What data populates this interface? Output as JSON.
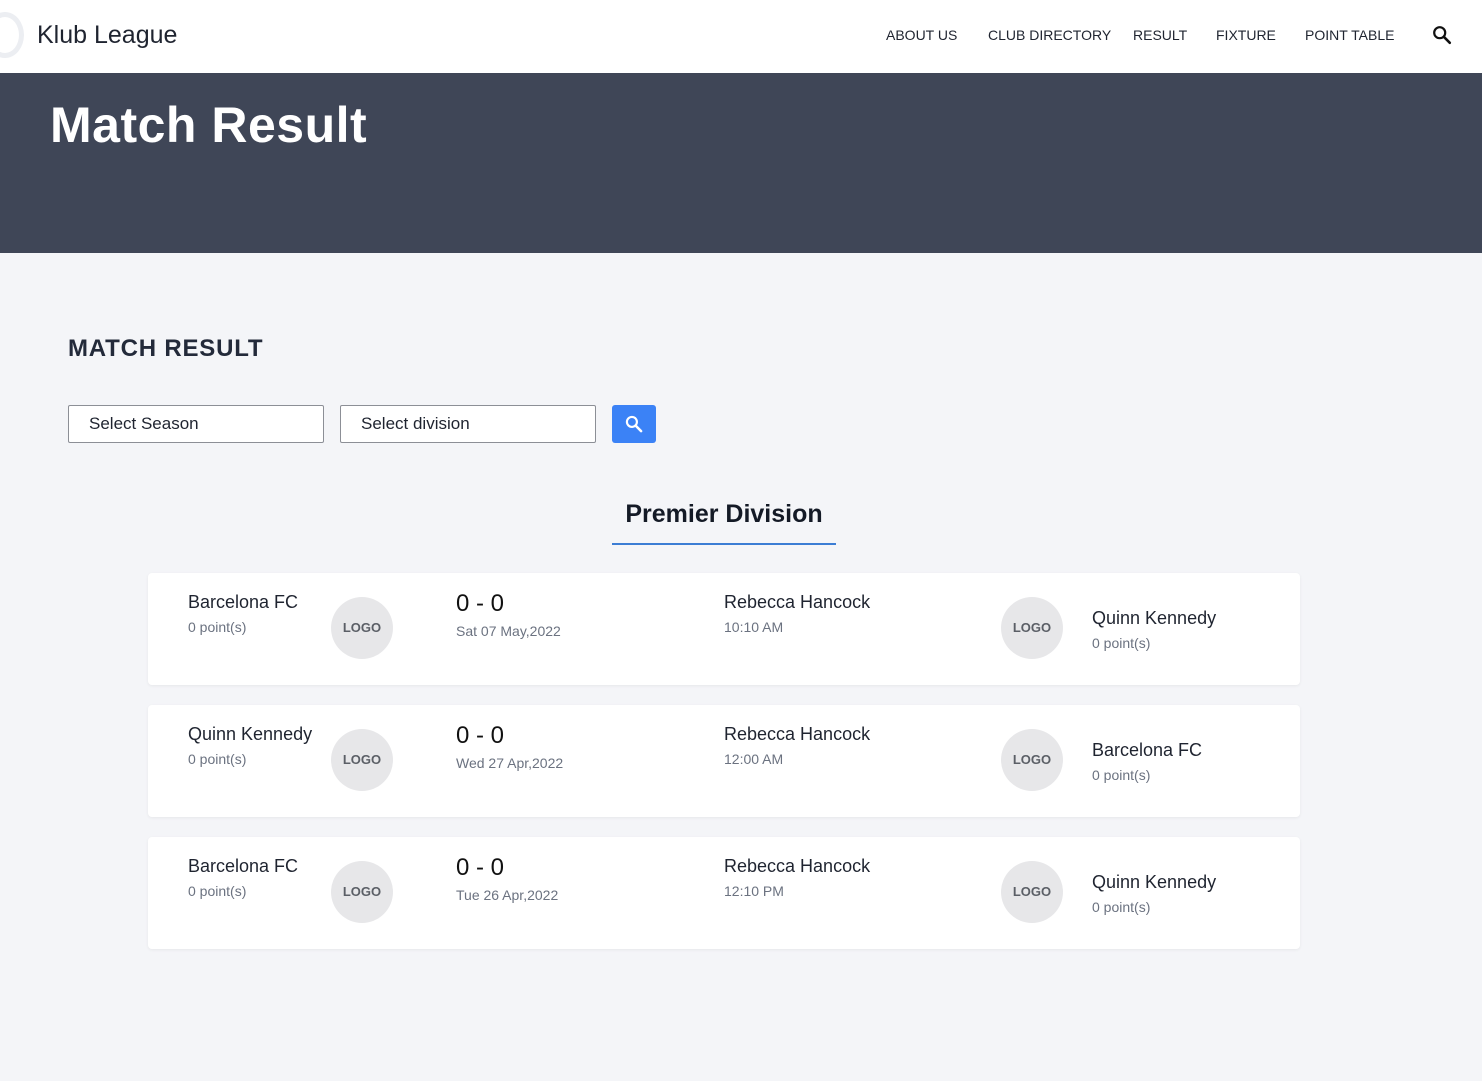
{
  "header": {
    "brand": "Klub League",
    "nav": [
      {
        "label": "ABOUT US"
      },
      {
        "label": "CLUB DIRECTORY"
      },
      {
        "label": "RESULT"
      },
      {
        "label": "FIXTURE"
      },
      {
        "label": "POINT TABLE"
      }
    ],
    "search_icon": "search-icon"
  },
  "hero": {
    "title": "Match Result"
  },
  "main": {
    "heading": "MATCH RESULT",
    "filters": {
      "season_placeholder": "Select Season",
      "division_placeholder": "Select division",
      "search_button_icon": "search-icon",
      "accent_color": "#3b82f6"
    },
    "division_tab": "Premier Division",
    "matches": [
      {
        "home": {
          "name": "Barcelona FC",
          "points": "0 point(s)",
          "logo": "LOGO"
        },
        "score": "0 - 0",
        "date": "Sat 07 May,2022",
        "venue": "Rebecca Hancock",
        "time": "10:10 AM",
        "away": {
          "name": "Quinn Kennedy",
          "points": "0 point(s)",
          "logo": "LOGO"
        }
      },
      {
        "home": {
          "name": "Quinn Kennedy",
          "points": "0 point(s)",
          "logo": "LOGO"
        },
        "score": "0 - 0",
        "date": "Wed 27 Apr,2022",
        "venue": "Rebecca Hancock",
        "time": "12:00 AM",
        "away": {
          "name": "Barcelona FC",
          "points": "0 point(s)",
          "logo": "LOGO"
        }
      },
      {
        "home": {
          "name": "Barcelona FC",
          "points": "0 point(s)",
          "logo": "LOGO"
        },
        "score": "0 - 0",
        "date": "Tue 26 Apr,2022",
        "venue": "Rebecca Hancock",
        "time": "12:10 PM",
        "away": {
          "name": "Quinn Kennedy",
          "points": "0 point(s)",
          "logo": "LOGO"
        }
      }
    ]
  },
  "colors": {
    "hero_background": "#3f4657",
    "page_background": "#f4f5f8",
    "tab_underline": "#3c7dd4"
  }
}
